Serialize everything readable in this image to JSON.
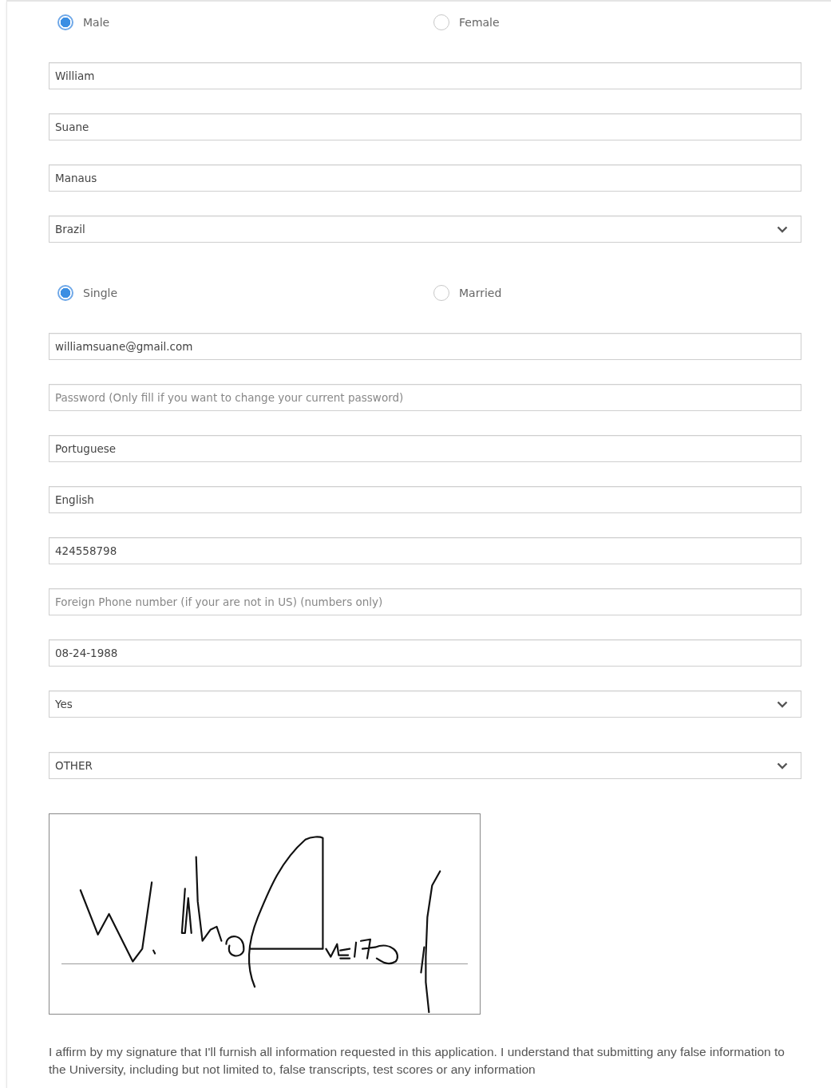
{
  "form": {
    "fields": [
      {
        "kind": "radio",
        "options": [
          {
            "label": "Male",
            "selected": true
          },
          {
            "label": "Female",
            "selected": false
          }
        ]
      },
      {
        "kind": "text",
        "value": "William"
      },
      {
        "kind": "text",
        "value": "Suane"
      },
      {
        "kind": "text",
        "value": "Manaus"
      },
      {
        "kind": "select",
        "value": "Brazil"
      },
      {
        "kind": "radio",
        "options": [
          {
            "label": "Single",
            "selected": true
          },
          {
            "label": "Married",
            "selected": false
          }
        ]
      },
      {
        "kind": "text",
        "value": "williamsuane@gmail.com"
      },
      {
        "kind": "text",
        "placeholder": "Password (Only fill if you want to change your current password)"
      },
      {
        "kind": "text",
        "value": "Portuguese"
      },
      {
        "kind": "text",
        "value": "English"
      },
      {
        "kind": "text",
        "value": "424558798"
      },
      {
        "kind": "text",
        "placeholder": "Foreign Phone number (if your are not in US) (numbers only)"
      },
      {
        "kind": "text",
        "value": "08-24-1988"
      },
      {
        "kind": "select",
        "value": "Yes"
      },
      {
        "kind": "select",
        "value": "OTHER"
      },
      {
        "kind": "signature"
      }
    ]
  },
  "affirmation": "I affirm by my signature that I'll furnish all information requested in this application. I understand that submitting any false information to the University, including but not limited to, false transcripts, test scores or any information"
}
